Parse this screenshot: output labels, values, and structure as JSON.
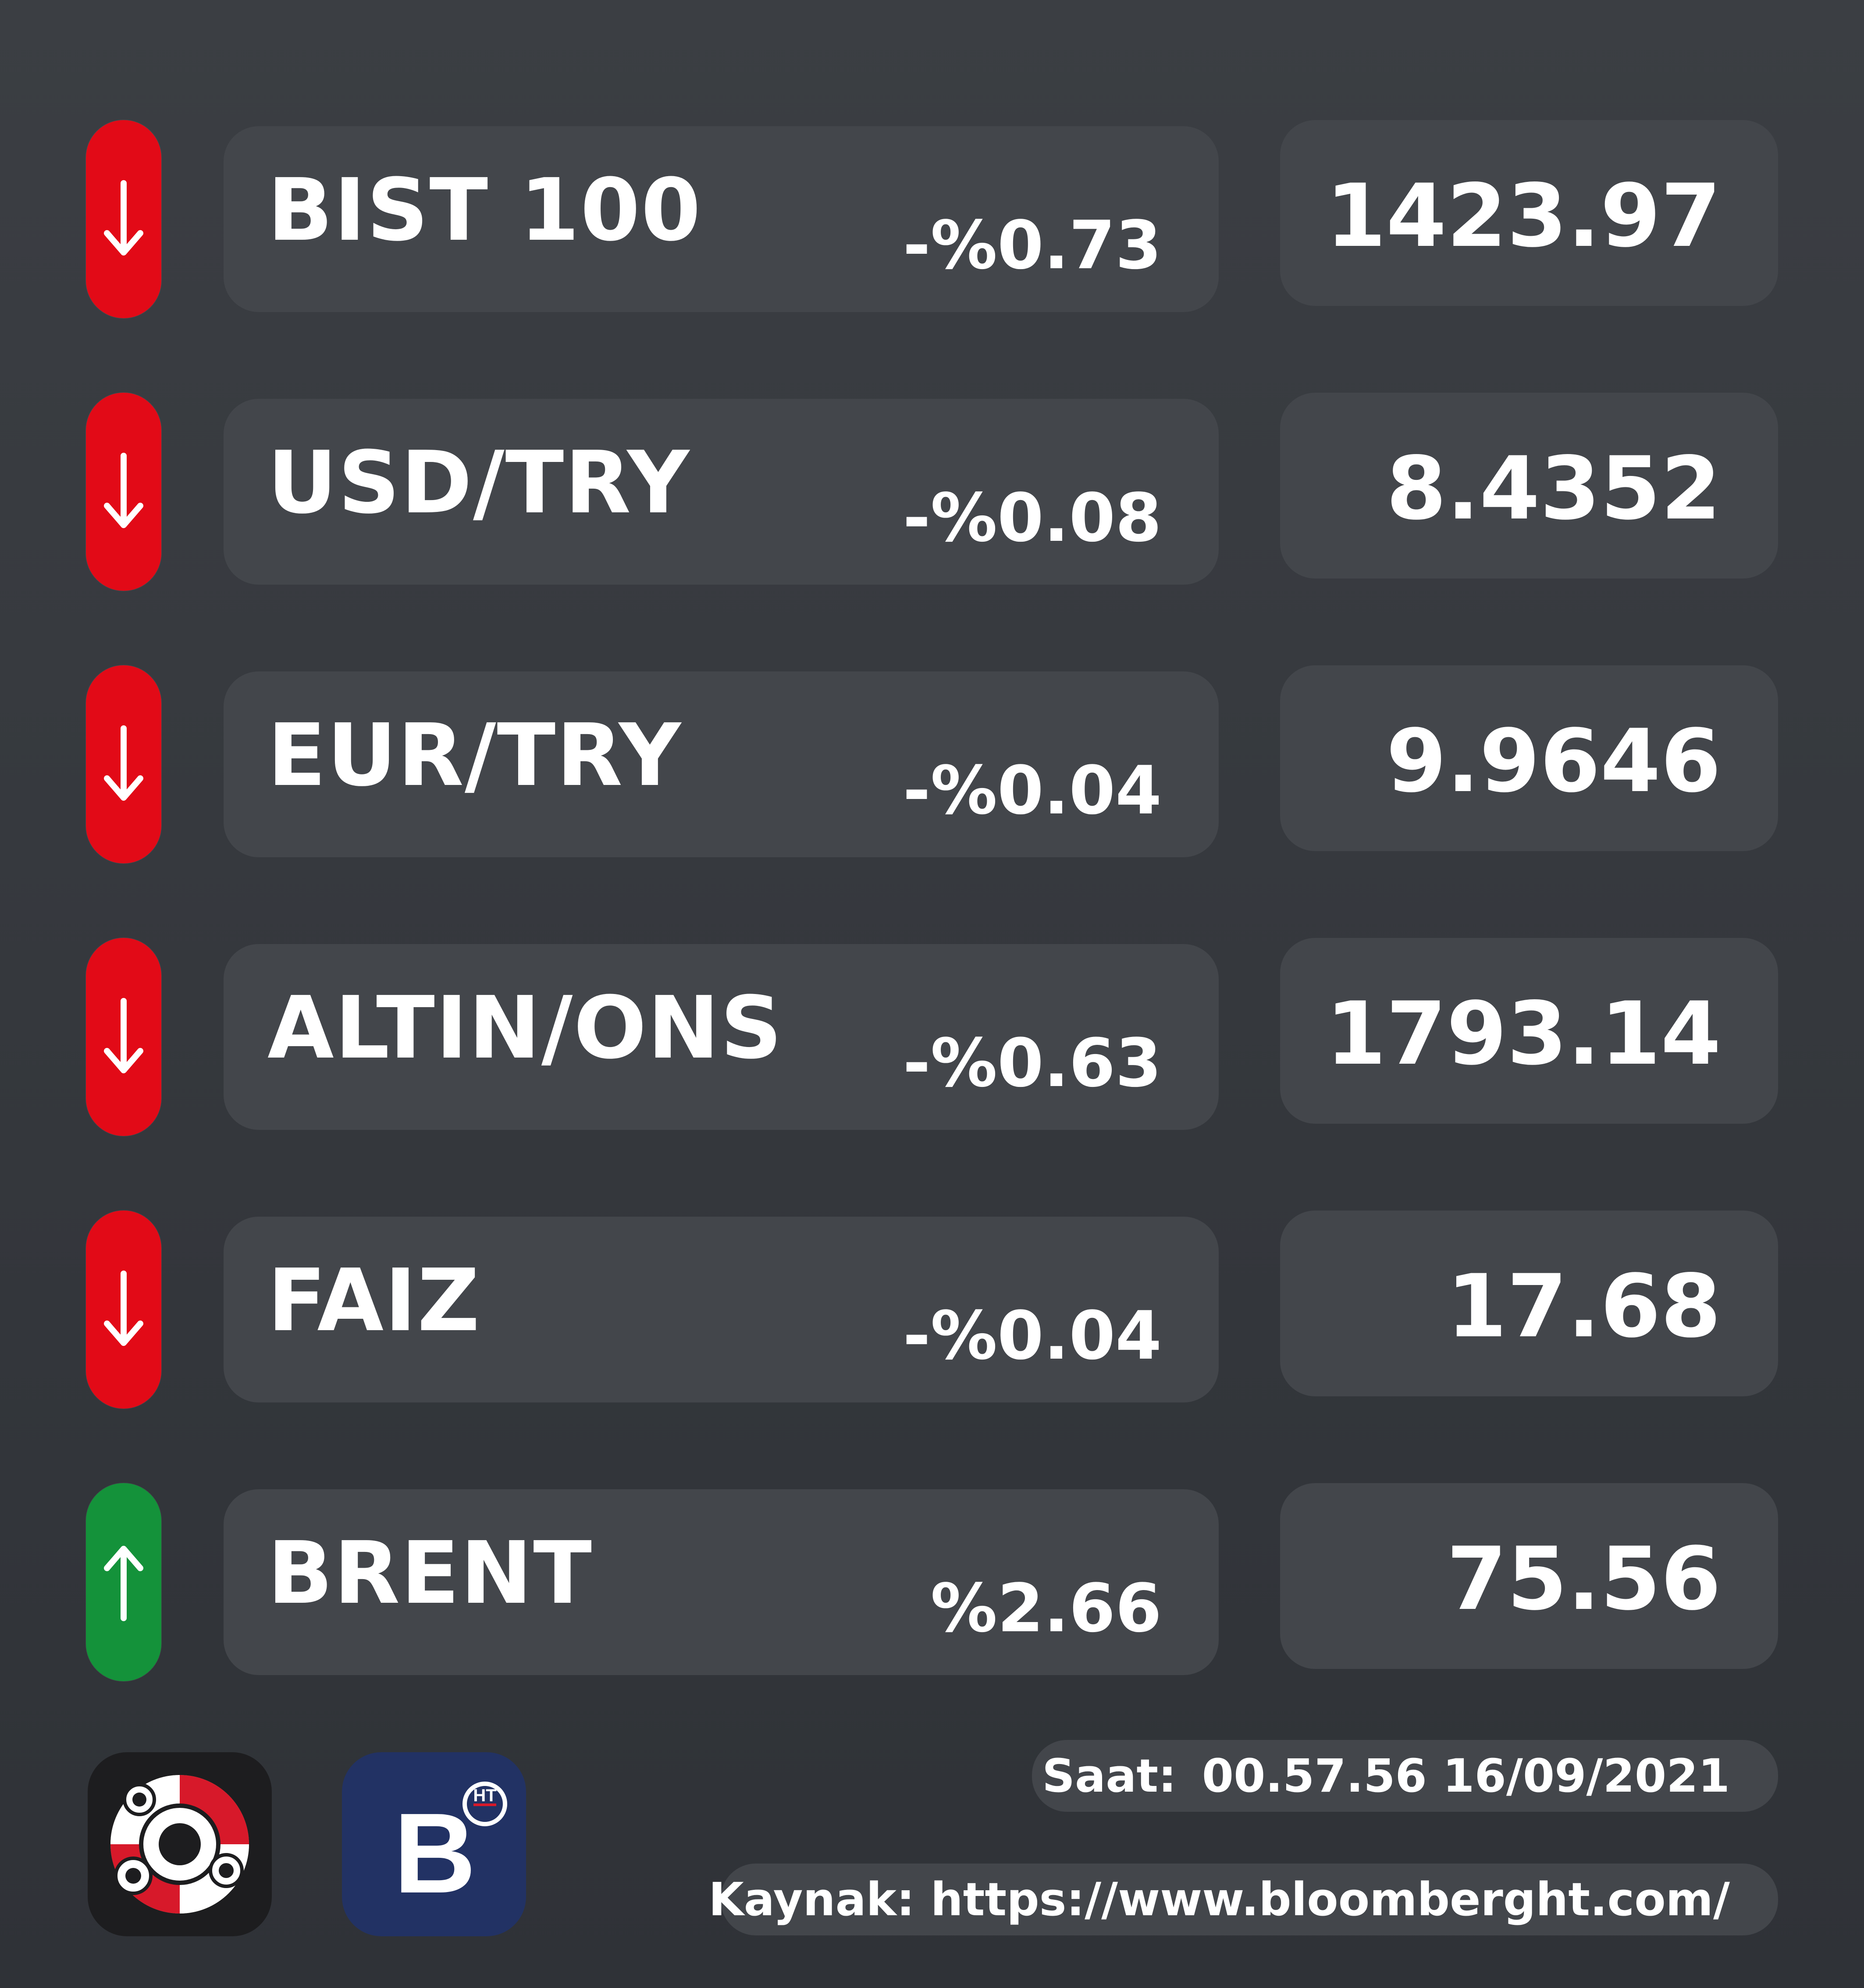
{
  "colors": {
    "down": "#e20a17",
    "up": "#14923a",
    "pill": "#43464b",
    "background": "#36393e",
    "text": "#ffffff"
  },
  "rows": [
    {
      "name": "BIST 100",
      "change": "-%0.73",
      "value": "1423.97",
      "direction": "down",
      "icon": "arrow-down-icon"
    },
    {
      "name": "USD/TRY",
      "change": "-%0.08",
      "value": "8.4352",
      "direction": "down",
      "icon": "arrow-down-icon"
    },
    {
      "name": "EUR/TRY",
      "change": "-%0.04",
      "value": "9.9646",
      "direction": "down",
      "icon": "arrow-down-icon"
    },
    {
      "name": "ALTIN/ONS",
      "change": "-%0.63",
      "value": "1793.14",
      "direction": "down",
      "icon": "arrow-down-icon"
    },
    {
      "name": "FAIZ",
      "change": "-%0.04",
      "value": "17.68",
      "direction": "down",
      "icon": "arrow-down-icon"
    },
    {
      "name": "BRENT",
      "change": "%2.66",
      "value": "75.56",
      "direction": "up",
      "icon": "arrow-up-icon"
    }
  ],
  "footer": {
    "time_label": "Saat:",
    "time_value": "00.57.56 16/09/2021",
    "source_label": "Kaynak: https://www.bloomberght.com/",
    "logo_letter": "B",
    "logo_badge": "HT",
    "left_logo_icon": "gears-icon",
    "right_logo_icon": "bloomberght-logo"
  }
}
